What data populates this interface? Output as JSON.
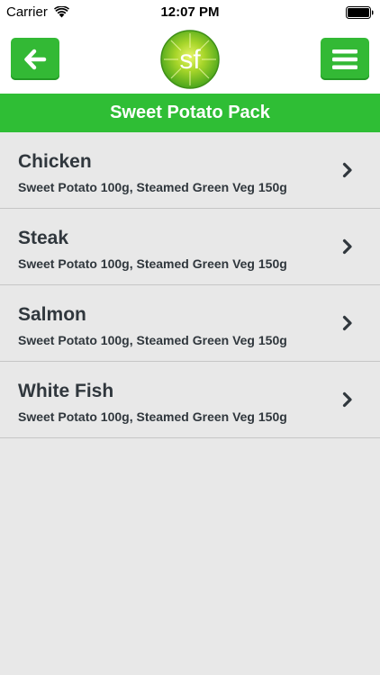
{
  "status_bar": {
    "carrier": "Carrier",
    "time": "12:07 PM"
  },
  "header": {
    "logo_text": "sf",
    "back_icon": "arrow-left-icon",
    "menu_icon": "hamburger-menu-icon"
  },
  "page_title": "Sweet Potato Pack",
  "items": [
    {
      "name": "Chicken",
      "desc": "Sweet Potato 100g, Steamed Green Veg 150g"
    },
    {
      "name": "Steak",
      "desc": "Sweet Potato 100g, Steamed Green Veg 150g"
    },
    {
      "name": "Salmon",
      "desc": "Sweet Potato 100g, Steamed Green Veg 150g"
    },
    {
      "name": "White Fish",
      "desc": "Sweet Potato 100g, Steamed Green Veg 150g"
    }
  ],
  "colors": {
    "accent_green": "#2fbe35",
    "text_dark": "#30373d",
    "background": "#e8e8e8"
  }
}
